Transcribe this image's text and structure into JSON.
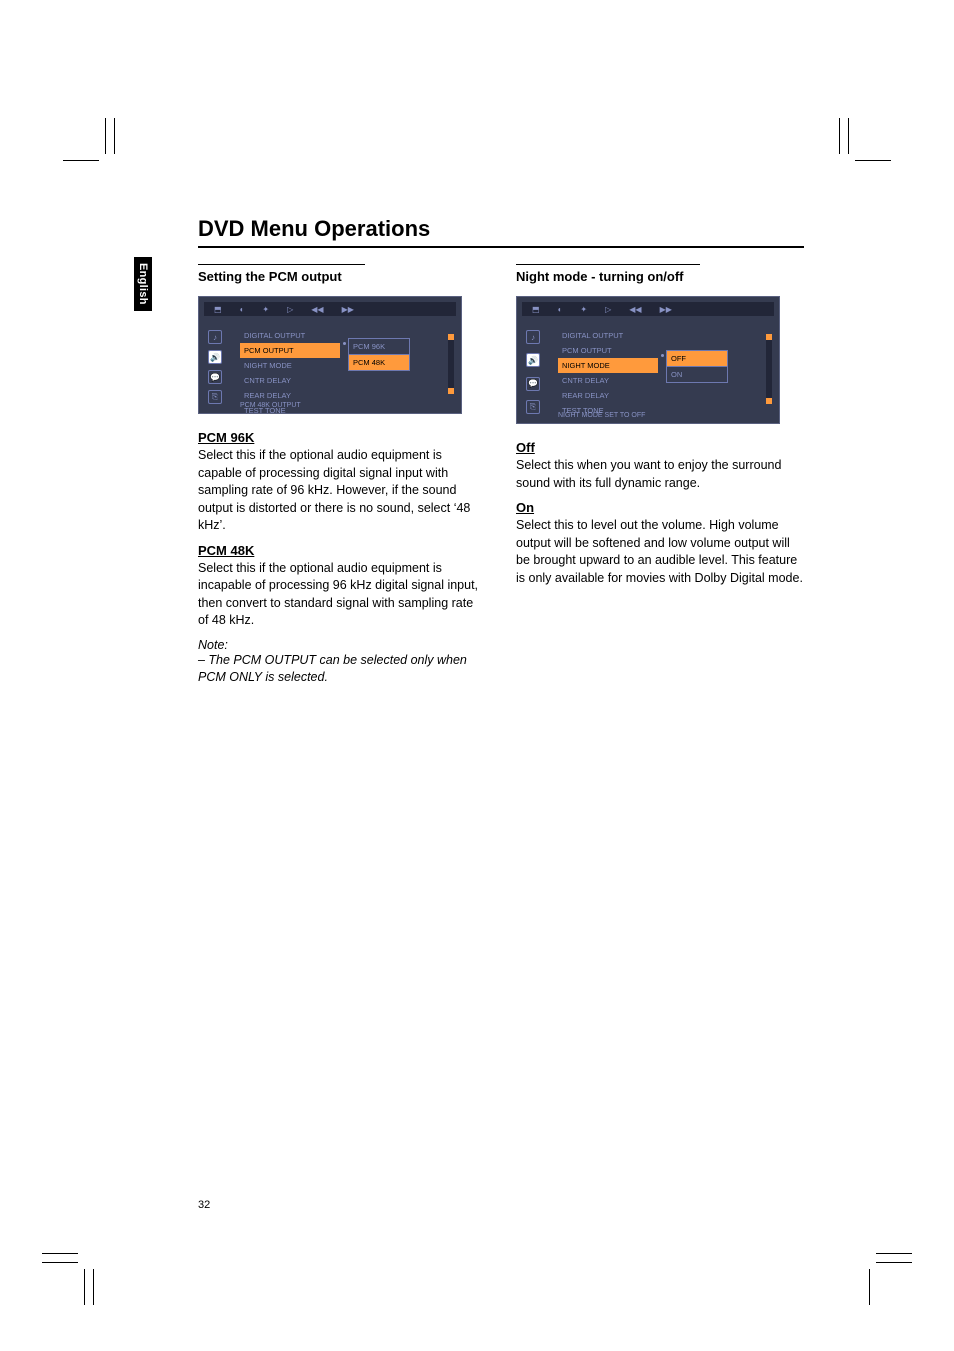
{
  "lang_tab": "English",
  "heading": "DVD Menu Operations",
  "left": {
    "section_head": "Setting the PCM output",
    "osd": {
      "menu": [
        "DIGITAL OUTPUT",
        "PCM OUTPUT",
        "NIGHT MODE",
        "CNTR DELAY",
        "REAR DELAY",
        "TEST TONE"
      ],
      "highlight_index": 1,
      "submenu": [
        "PCM 96K",
        "PCM 48K"
      ],
      "sub_highlight_index": 1,
      "status": "PCM 48K OUTPUT"
    },
    "opt1_head": "PCM 96K",
    "opt1_body": "Select this if the optional audio equipment is capable of processing digital signal input with sampling rate of 96 kHz. However, if the sound output is distorted or there is no sound, select ‘48 kHz’.",
    "opt2_head": "PCM 48K",
    "opt2_body": "Select this if the optional audio equipment is incapable of processing 96 kHz digital signal input, then convert to standard signal with sampling rate of 48 kHz.",
    "note_label": "Note:",
    "note": "–  The PCM OUTPUT can be selected only when PCM ONLY is selected."
  },
  "right": {
    "section_head": "Night mode - turning on/off",
    "osd": {
      "menu": [
        "DIGITAL OUTPUT",
        "PCM OUTPUT",
        "NIGHT MODE",
        "CNTR DELAY",
        "REAR DELAY",
        "TEST TONE"
      ],
      "highlight_index": 2,
      "submenu": [
        "OFF",
        "ON"
      ],
      "sub_highlight_index": 0,
      "status": "NIGHT MODE SET TO OFF"
    },
    "opt1_head": "Off",
    "opt1_body": "Select this when you want to enjoy the surround sound with its full dynamic range.",
    "opt2_head": "On",
    "opt2_body": "Select this to level out the volume. High volume output will be softened and low volume output will be brought upward to an audible level. This feature is only available for movies with Dolby Digital mode."
  },
  "page_number": "32",
  "icons": {
    "fit": "⬒",
    "play": "▷",
    "rew": "◀◀",
    "fwd": "▶▶",
    "general": "♬",
    "speaker": "🔊",
    "lang": "💬",
    "pref": "⚙"
  }
}
